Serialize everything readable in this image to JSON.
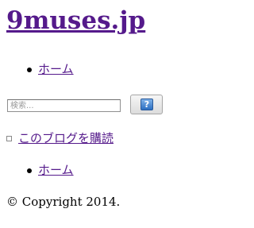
{
  "site": {
    "title": "9muses.jp"
  },
  "nav_top": {
    "items": [
      {
        "label": "ホーム"
      }
    ]
  },
  "search": {
    "value": "",
    "placeholder": "検索...",
    "button_icon": "search-help-icon",
    "button_glyph": "?"
  },
  "subscribe": {
    "icon": "feed-icon",
    "label": "このブログを購読"
  },
  "nav_bottom": {
    "items": [
      {
        "label": "ホーム"
      }
    ]
  },
  "footer": {
    "copyright": "© Copyright 2014."
  }
}
